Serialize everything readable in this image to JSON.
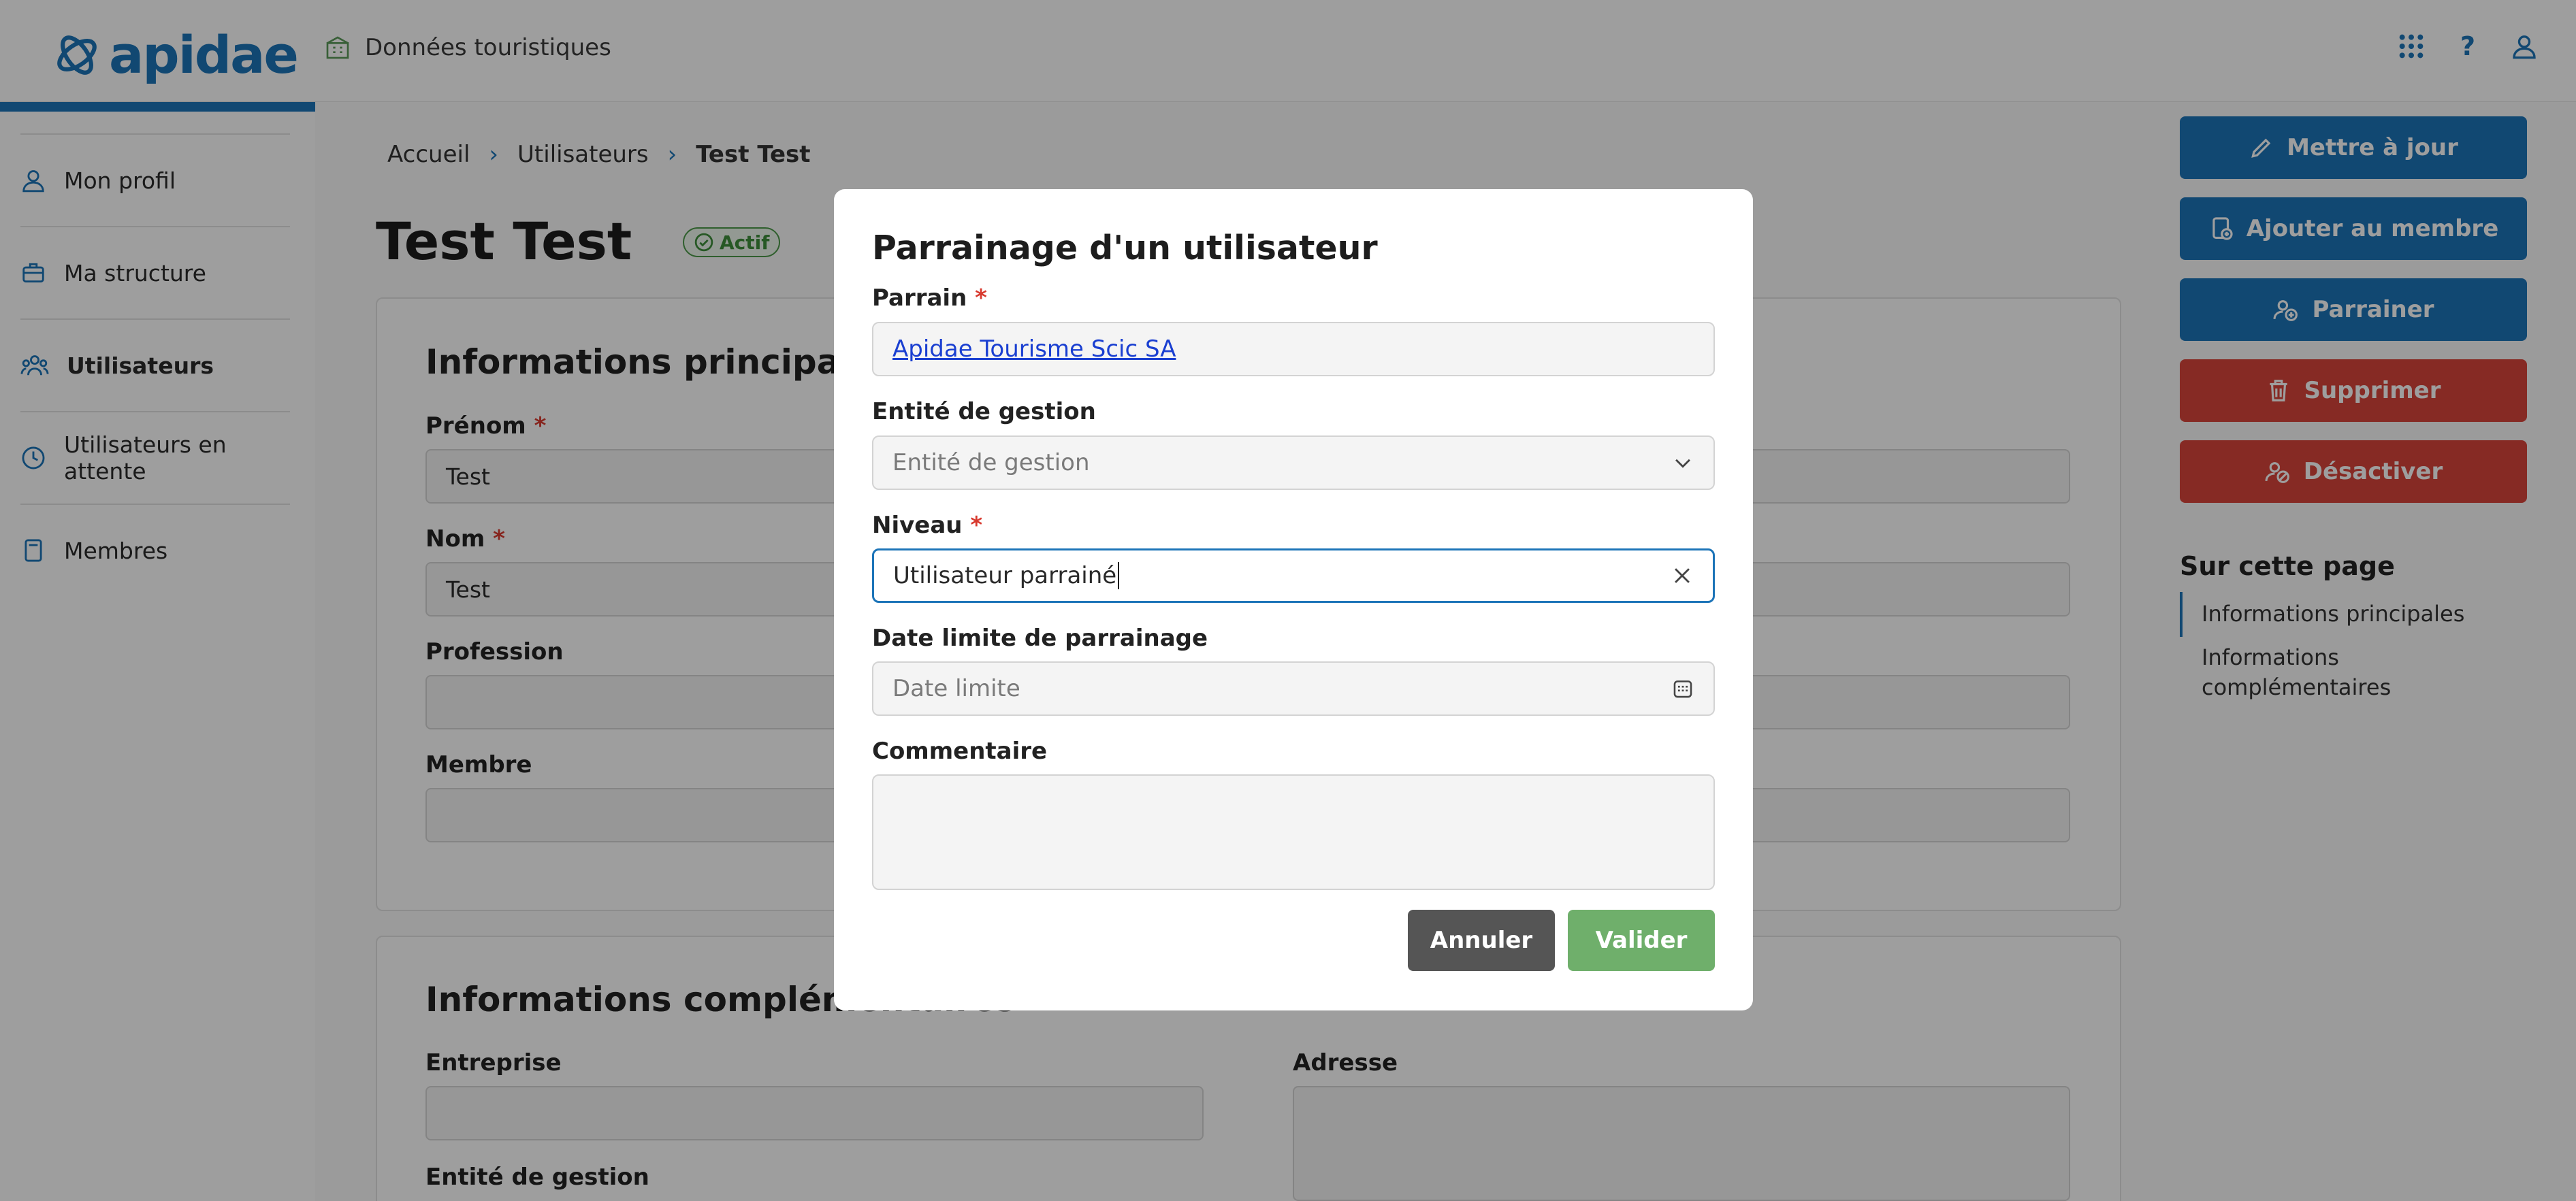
{
  "brand": {
    "name": "apidae",
    "color": "#1c74b8"
  },
  "topbar": {
    "app_name": "Données touristiques",
    "icons": [
      "apps-grid-icon",
      "help-icon",
      "user-icon"
    ],
    "help_label": "?"
  },
  "sidebar": {
    "items": [
      {
        "label": "Mon profil",
        "icon": "user-icon",
        "active": false
      },
      {
        "label": "Ma structure",
        "icon": "briefcase-icon",
        "active": false
      },
      {
        "label": "Utilisateurs",
        "icon": "users-icon",
        "active": true
      },
      {
        "label": "Utilisateurs en attente",
        "icon": "clock-icon",
        "active": false
      },
      {
        "label": "Membres",
        "icon": "document-icon",
        "active": false
      }
    ]
  },
  "breadcrumb": {
    "items": [
      "Accueil",
      "Utilisateurs",
      "Test Test"
    ]
  },
  "page": {
    "title": "Test Test",
    "status": "Actif"
  },
  "main_info": {
    "title": "Informations principales",
    "fields": {
      "prenom_label": "Prénom",
      "prenom_value": "Test",
      "nom_label": "Nom",
      "nom_value": "Test",
      "profession_label": "Profession",
      "membre_label": "Membre"
    }
  },
  "extra_info": {
    "title": "Informations complémentaires",
    "entreprise_label": "Entreprise",
    "adresse_label": "Adresse",
    "entite_label": "Entité de gestion"
  },
  "actions": {
    "update": "Mettre à jour",
    "add_member": "Ajouter au membre",
    "sponsor": "Parrainer",
    "delete": "Supprimer",
    "deactivate": "Désactiver"
  },
  "toc": {
    "title": "Sur cette page",
    "items": [
      "Informations principales",
      "Informations complémentaires"
    ],
    "items_wrapped": [
      "Informations",
      "complémentaires"
    ]
  },
  "modal": {
    "title": "Parrainage d'un utilisateur",
    "parrain_label": "Parrain",
    "parrain_value": "Apidae Tourisme Scic SA",
    "entite_label": "Entité de gestion",
    "entite_placeholder": "Entité de gestion",
    "niveau_label": "Niveau",
    "niveau_value": "Utilisateur parrainé",
    "date_label": "Date limite de parrainage",
    "date_placeholder": "Date limite",
    "comment_label": "Commentaire",
    "comment_value": "",
    "cancel": "Annuler",
    "submit": "Valider"
  },
  "required_marker": "*",
  "colors": {
    "primary": "#1c74b8",
    "danger": "#d9453a",
    "success": "#6faf6b",
    "neutral_button": "#555555",
    "required": "#d83a2f"
  }
}
